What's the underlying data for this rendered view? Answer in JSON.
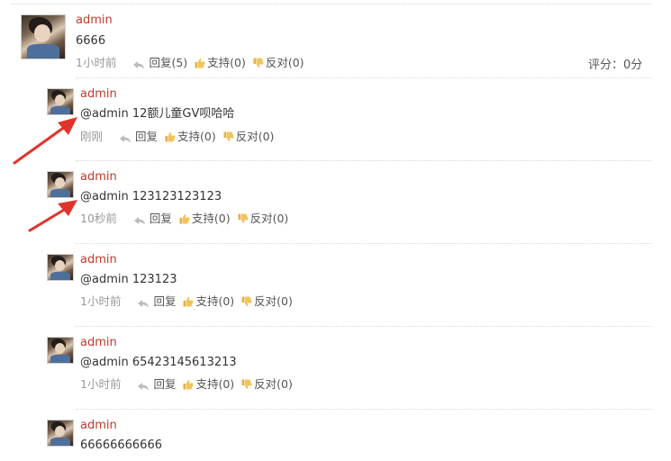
{
  "comments": [
    {
      "author": "admin",
      "text": "6666",
      "time": "1小时前",
      "reply": "回复(5)",
      "support": "支持(0)",
      "oppose": "反对(0)",
      "score_label": "评分：",
      "score_value": "0分"
    },
    {
      "author": "admin",
      "text": "@admin 12额儿童GV呗哈哈",
      "time": "刚刚",
      "reply": "回复",
      "support": "支持(0)",
      "oppose": "反对(0)"
    },
    {
      "author": "admin",
      "text": "@admin 123123123123",
      "time": "10秒前",
      "reply": "回复",
      "support": "支持(0)",
      "oppose": "反对(0)"
    },
    {
      "author": "admin",
      "text": "@admin 123123",
      "time": "1小时前",
      "reply": "回复",
      "support": "支持(0)",
      "oppose": "反对(0)"
    },
    {
      "author": "admin",
      "text": "@admin 65423145613213",
      "time": "1小时前",
      "reply": "回复",
      "support": "支持(0)",
      "oppose": "反对(0)"
    },
    {
      "author": "admin",
      "text": "66666666666",
      "time": "",
      "reply": "",
      "support": "",
      "oppose": ""
    }
  ],
  "colors": {
    "author": "#c0392b",
    "arrow": "#e0342b",
    "muted": "#999999"
  },
  "icons": [
    "avatar",
    "reply-icon",
    "thumbs-up-icon",
    "thumbs-down-icon",
    "annotation-arrow"
  ]
}
